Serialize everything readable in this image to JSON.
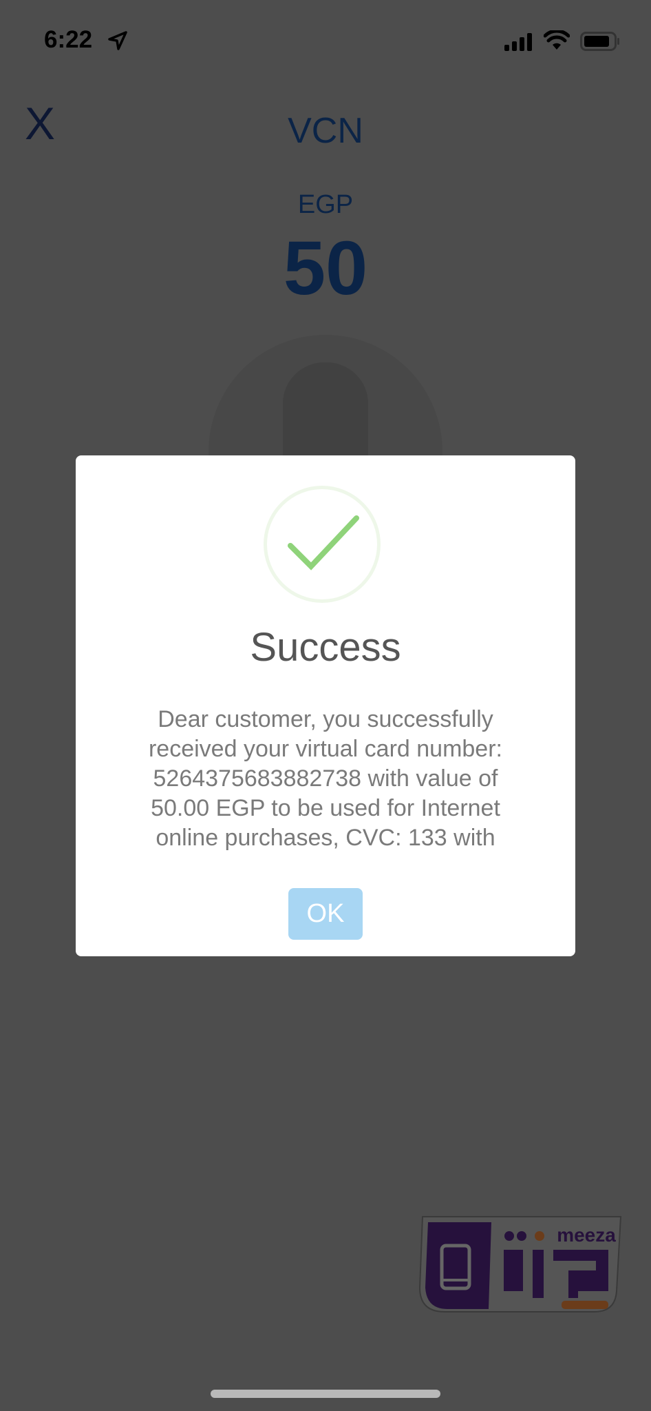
{
  "status_bar": {
    "time": "6:22",
    "icons": [
      "location-arrow-icon",
      "cellular-signal-icon",
      "wifi-icon",
      "battery-icon"
    ]
  },
  "header": {
    "close_label": "X",
    "title": "VCN"
  },
  "amount": {
    "currency": "EGP",
    "value": "50"
  },
  "dialog": {
    "icon": "checkmark-icon",
    "title": "Success",
    "message_lines": [
      "Dear customer, you successfully",
      "received your virtual card number:",
      "5264375683882738 with value of",
      "50.00 EGP to be used for Internet",
      "online purchases, CVC: 133 with"
    ],
    "ok_label": "OK"
  },
  "logo": {
    "text_latin": "meeza",
    "text_arabic": "ميزة"
  },
  "colors": {
    "accent": "#0b2447",
    "success_green": "#8fd37a",
    "ok_button": "#a8d6f3",
    "overlay": "#4d4d4d"
  }
}
